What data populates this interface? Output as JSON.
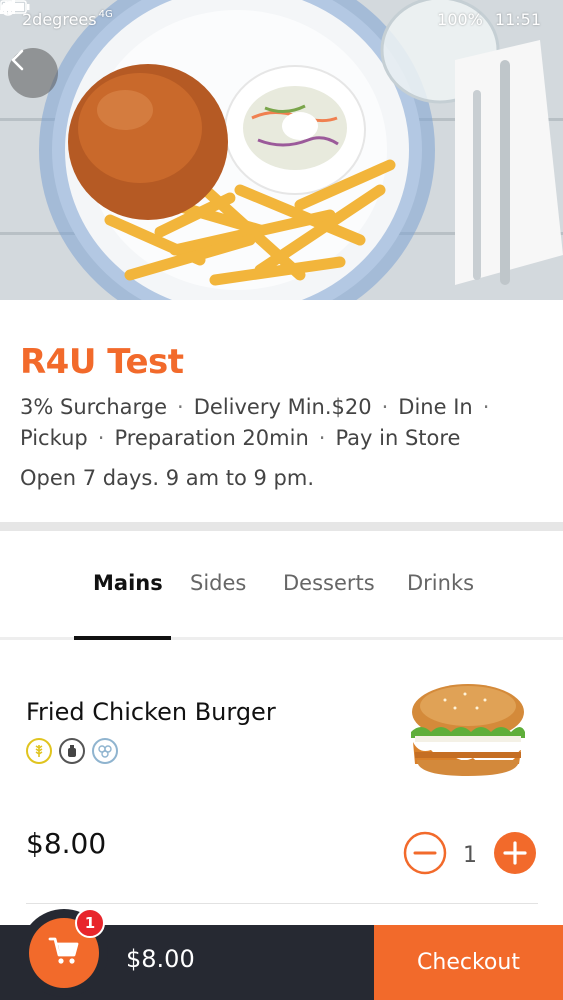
{
  "status_bar": {
    "carrier": "2degrees",
    "network": "4G",
    "battery": "100%",
    "time": "11:51"
  },
  "store": {
    "name": "R4U Test",
    "meta_line1": [
      "3% Surcharge",
      "Delivery Min.$20",
      "Dine In"
    ],
    "meta_line2": [
      "Pickup",
      "Preparation 20min",
      "Pay in Store"
    ],
    "separator": "·",
    "hours": "Open 7 days. 9 am to 9 pm."
  },
  "tabs": [
    {
      "label": "Mains",
      "active": true
    },
    {
      "label": "Sides",
      "active": false
    },
    {
      "label": "Desserts",
      "active": false
    },
    {
      "label": "Drinks",
      "active": false
    }
  ],
  "item": {
    "name": "Fried Chicken Burger",
    "price": "$8.00",
    "quantity": "1",
    "diet_icons": [
      "gluten-icon",
      "allergen-bottle-icon",
      "allergen-group-icon"
    ]
  },
  "cart": {
    "badge_count": "1",
    "total": "$8.00",
    "checkout_label": "Checkout"
  },
  "colors": {
    "accent": "#f26a2b",
    "bar": "#262932",
    "badge": "#e8262c"
  }
}
